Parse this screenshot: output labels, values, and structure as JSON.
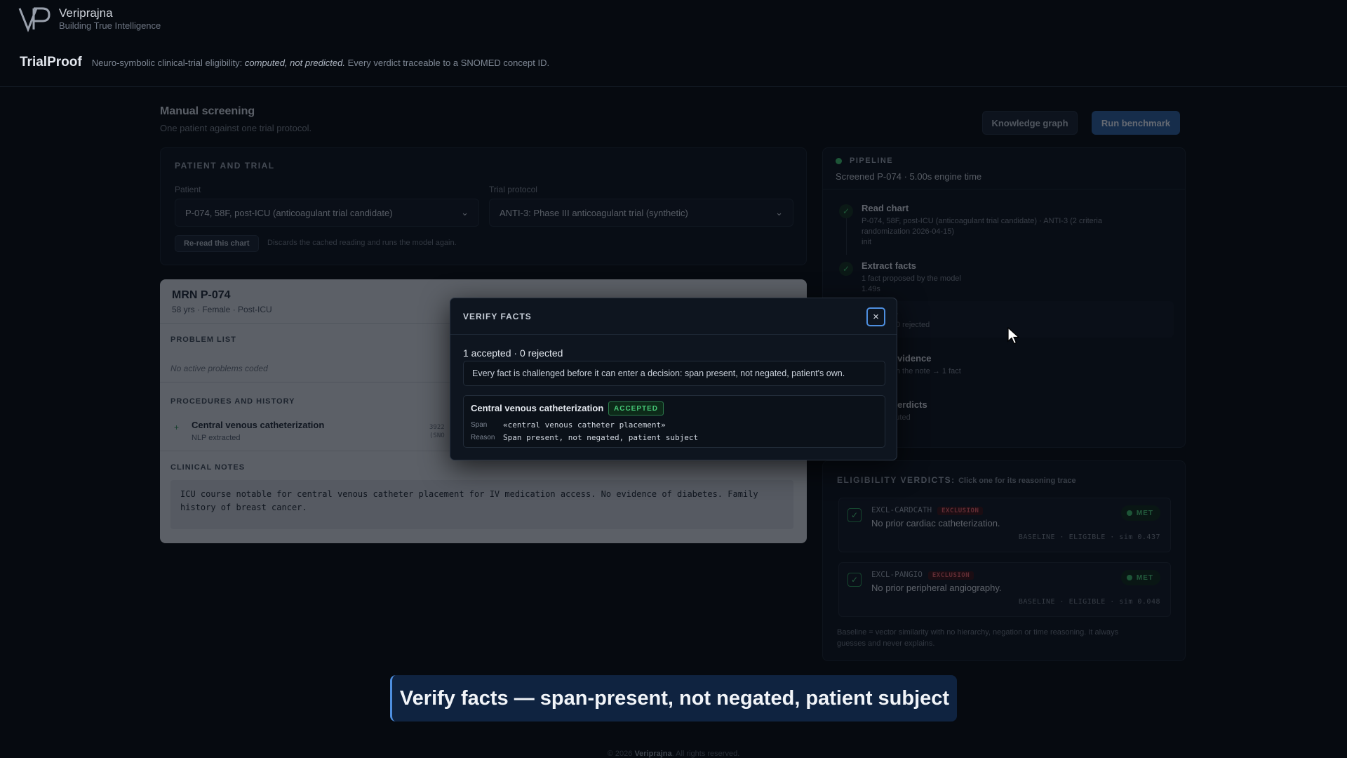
{
  "brand": {
    "name": "Veriprajna",
    "tagline": "Building True Intelligence"
  },
  "app": {
    "title": "TrialProof",
    "subtitle_pre": "Neuro-symbolic clinical-trial eligibility: ",
    "subtitle_em": "computed, not predicted.",
    "subtitle_post": " Every verdict traceable to a SNOMED concept ID."
  },
  "screening": {
    "title": "Manual screening",
    "subtitle": "One patient against one trial protocol.",
    "knowledge_graph_label": "Knowledge graph",
    "run_benchmark_label": "Run benchmark"
  },
  "patient_trial": {
    "heading": "Patient and trial",
    "patient_label": "Patient",
    "patient_value": "P-074, 58F, post-ICU (anticoagulant trial candidate)",
    "trial_label": "Trial protocol",
    "trial_value": "ANTI-3: Phase III anticoagulant trial (synthetic)",
    "reread_label": "Re-read this chart",
    "reread_note": "Discards the cached reading and runs the model again."
  },
  "chart": {
    "mrn": "MRN P-074",
    "demographics": "58 yrs · Female · Post-ICU",
    "problem_list_heading": "Problem list",
    "problem_list_empty": "No active problems coded",
    "procedures_heading": "Procedures and history",
    "procedure_name": "Central venous catheterization",
    "procedure_source": "NLP extracted",
    "procedure_code_partial": "3922",
    "procedure_code_partial2": "(SNO",
    "notes_heading": "Clinical notes",
    "notes_text": "ICU course notable for central venous catheter placement for IV medication access. No evidence of diabetes. Family history of breast cancer."
  },
  "pipeline": {
    "heading": "Pipeline",
    "status": "Screened P-074 · 5.00s engine time",
    "steps": [
      {
        "title": "Read chart",
        "sub1": "P-074, 58F, post-ICU (anticoagulant trial candidate) · ANTI-3 (2 criteria",
        "sub2": "randomization 2026-04-15)",
        "sub3": "init"
      },
      {
        "title": "Extract facts",
        "sub1": "1 fact proposed by the model",
        "sub2": "1.49s"
      },
      {
        "title": "cts",
        "sub1": "1 · 0 rejected"
      },
      {
        "title": "e evidence",
        "sub1": "from the note → 1 fact"
      },
      {
        "title": "e verdicts",
        "sub1": "mputed"
      }
    ]
  },
  "verdicts": {
    "heading": "Eligibility verdicts:",
    "heading_note": "Click one for its reasoning trace",
    "items": [
      {
        "id": "EXCL-CARDCATH",
        "tag": "EXCLUSION",
        "text": "No prior cardiac catheterization.",
        "status": "MET",
        "baseline": "BASELINE · ELIGIBLE · sim 0.437"
      },
      {
        "id": "EXCL-PANGIO",
        "tag": "EXCLUSION",
        "text": "No prior peripheral angiography.",
        "status": "MET",
        "baseline": "BASELINE · ELIGIBLE · sim 0.048"
      }
    ],
    "footnote": "Baseline = vector similarity with no hierarchy, negation or time reasoning. It always guesses and never explains."
  },
  "modal": {
    "title": "VERIFY FACTS",
    "close_glyph": "×",
    "summary": "1 accepted · 0 rejected",
    "note": "Every fact is challenged before it can enter a decision: span present, not negated, patient's own.",
    "fact": {
      "name": "Central venous catheterization",
      "badge": "ACCEPTED",
      "span_label": "Span",
      "span_value": "«central venous catheter placement»",
      "reason_label": "Reason",
      "reason_value": "Span present, not negated, patient subject"
    }
  },
  "caption": "Verify facts — span-present, not negated, patient subject",
  "footer": {
    "pre": "© 2026 ",
    "brand": "Veriprajna",
    "post": ". All rights reserved."
  },
  "colors": {
    "accent": "#4e8fe0",
    "success": "#3fbf6f",
    "danger": "#e05e66",
    "background": "#060a10"
  },
  "icons": {
    "close": "close-icon",
    "check": "check-icon",
    "chevron": "chevron-down-icon",
    "cursor": "cursor-icon"
  }
}
